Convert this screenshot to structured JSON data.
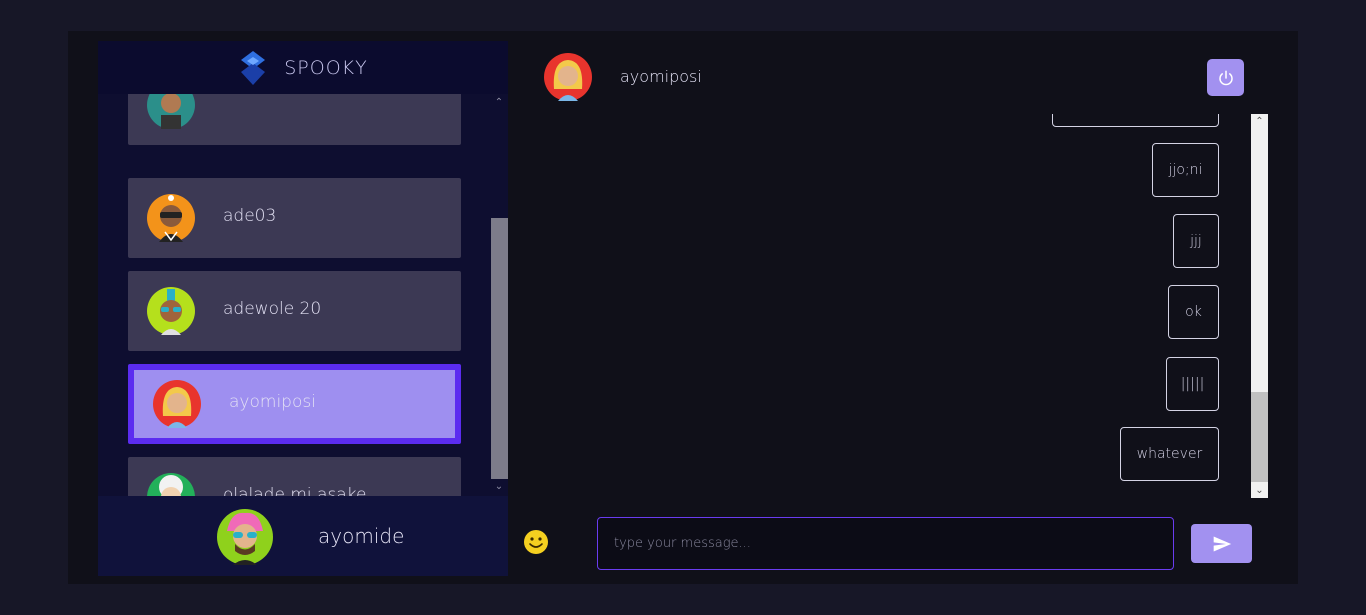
{
  "app": {
    "brand_name": "SPOOKY",
    "accent_color": "#9e8ff0",
    "active_border_color": "#5b2cf0"
  },
  "contacts": [
    {
      "name": "",
      "avatar": "teal-avatar-icon"
    },
    {
      "name": "ade03",
      "avatar": "orange-sunglasses-avatar-icon"
    },
    {
      "name": "adewole 20",
      "avatar": "lime-mohawk-avatar-icon"
    },
    {
      "name": "ayomiposi",
      "avatar": "red-blonde-avatar-icon",
      "active": true
    },
    {
      "name": "olalade mi asake",
      "avatar": "green-whitehair-avatar-icon"
    }
  ],
  "current_user": {
    "name": "ayomide",
    "avatar": "lime-pinkhair-avatar-icon"
  },
  "chat": {
    "partner_name": "ayomiposi",
    "partner_avatar": "red-blonde-avatar-icon",
    "messages": [
      {
        "text": ""
      },
      {
        "text": "jjo;ni"
      },
      {
        "text": "jjj"
      },
      {
        "text": "ok"
      },
      {
        "text": "|||||"
      },
      {
        "text": "whatever"
      }
    ],
    "input_placeholder": "type your message...",
    "input_value": ""
  },
  "icons": {
    "power": "power-icon",
    "send": "send-icon",
    "emoji": "smiley-emoji-icon",
    "logo": "spooky-logo-icon"
  }
}
